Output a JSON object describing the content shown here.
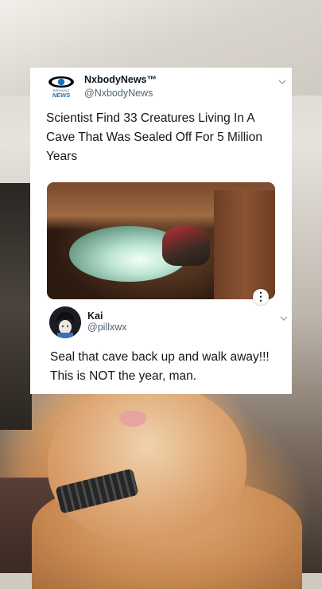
{
  "tweet": {
    "author_name": "NxbodyNews™",
    "author_handle": "@NxbodyNews",
    "logo_text": "BREAKING NEWS",
    "text": "Scientist Find 33 Creatures Living In A Cave That Was Sealed Off For 5 Million Years",
    "media_more_label": "⋮"
  },
  "reply": {
    "author_name": "Kai",
    "author_handle": "@pillxwx",
    "text": "Seal that cave back up and walk away!!! This is NOT the year, man."
  },
  "colors": {
    "text_primary": "#14171a",
    "text_secondary": "#536471",
    "card_bg": "#ffffff",
    "logo_blue": "#1c6fb8"
  },
  "icons": {
    "tweet_menu": "chevron-down-icon",
    "reply_menu": "chevron-down-icon",
    "media_menu": "more-vertical-icon"
  }
}
